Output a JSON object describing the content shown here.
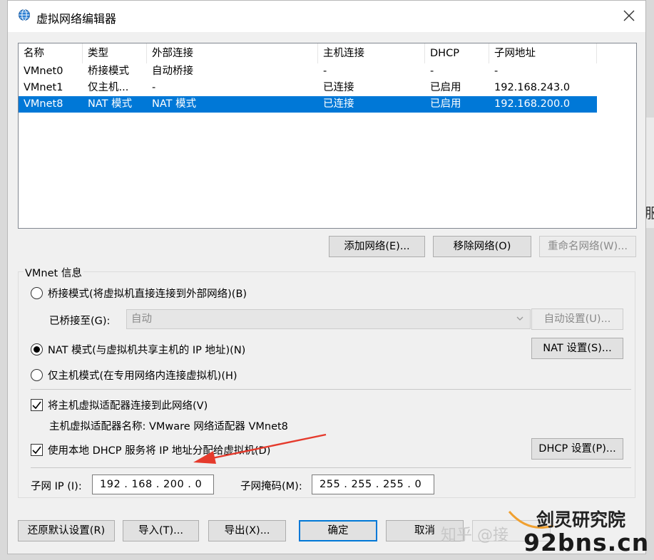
{
  "dialog": {
    "title": "虚拟网络编辑器"
  },
  "list": {
    "columns": [
      "名称",
      "类型",
      "外部连接",
      "主机连接",
      "DHCP",
      "子网地址"
    ],
    "rows": [
      [
        "VMnet0",
        "桥接模式",
        "自动桥接",
        "-",
        "-",
        "-"
      ],
      [
        "VMnet1",
        "仅主机...",
        "-",
        "已连接",
        "已启用",
        "192.168.243.0"
      ],
      [
        "VMnet8",
        "NAT 模式",
        "NAT 模式",
        "已连接",
        "已启用",
        "192.168.200.0"
      ]
    ]
  },
  "list_buttons": {
    "add": "添加网络(E)...",
    "remove": "移除网络(O)",
    "rename": "重命名网络(W)..."
  },
  "vmnet_info": {
    "label": "VMnet 信息",
    "bridged_label": "桥接模式(将虚拟机直接连接到外部网络)(B)",
    "bridged_to_label": "已桥接至(G):",
    "bridged_to_value": "自动",
    "auto_settings": "自动设置(U)...",
    "nat_label": "NAT 模式(与虚拟机共享主机的 IP 地址)(N)",
    "nat_settings": "NAT 设置(S)...",
    "hostonly_label": "仅主机模式(在专用网络内连接虚拟机)(H)",
    "connect_adapter_label": "将主机虚拟适配器连接到此网络(V)",
    "adapter_name_text": "主机虚拟适配器名称: VMware 网络适配器 VMnet8",
    "dhcp_label": "使用本地 DHCP 服务将 IP 地址分配给虚拟机(D)",
    "dhcp_settings": "DHCP 设置(P)...",
    "subnet_ip_label": "子网 IP (I):",
    "subnet_ip_value": "192 . 168 . 200 .  0",
    "subnet_mask_label": "子网掩码(M):",
    "subnet_mask_value": "255 . 255 . 255 .  0"
  },
  "footer": {
    "restore": "还原默认设置(R)",
    "import": "导入(T)...",
    "export": "导出(X)...",
    "ok": "确定",
    "cancel": "取消"
  },
  "watermark": {
    "zhihu": "知乎 @接",
    "brand_cn": "剑灵研究院",
    "brand_url": "92bns.cn",
    "side_glyph": "服"
  },
  "colors": {
    "selection": "#0078d7",
    "arrow": "#e53a2c"
  }
}
